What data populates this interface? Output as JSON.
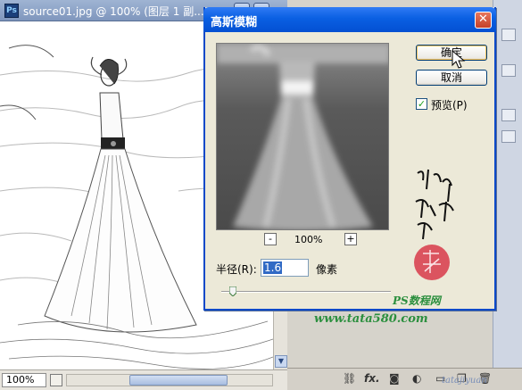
{
  "document": {
    "title": "source01.jpg @ 100% (图层 1 副...",
    "app_icon_label": "Ps",
    "zoom": "100%"
  },
  "dialog": {
    "title": "高斯模糊",
    "close_glyph": "✕",
    "ok_label": "确定",
    "cancel_label": "取消",
    "preview_label": "预览(P)",
    "preview_checked": true,
    "zoom_out_glyph": "-",
    "zoom_in_glyph": "+",
    "preview_zoom": "100%",
    "radius_label": "半径(R):",
    "radius_value": "1.6",
    "radius_unit": "像素",
    "slider_position": 0.07
  },
  "watermark": {
    "brand": "PS数程网",
    "site": "www.tata580.com",
    "corner": "tatajiyuan"
  },
  "layers_toolbar": {
    "icons": [
      "link-icon",
      "fx-icon",
      "mask-icon",
      "adjustment-icon",
      "folder-icon",
      "new-layer-icon",
      "trash-icon"
    ],
    "fx_label": "fx."
  },
  "colors": {
    "xp_title_blue": "#0a5fe2",
    "close_red": "#c5402a",
    "watermark_green": "#2b8f3e",
    "seal_red": "#d83a4a"
  }
}
